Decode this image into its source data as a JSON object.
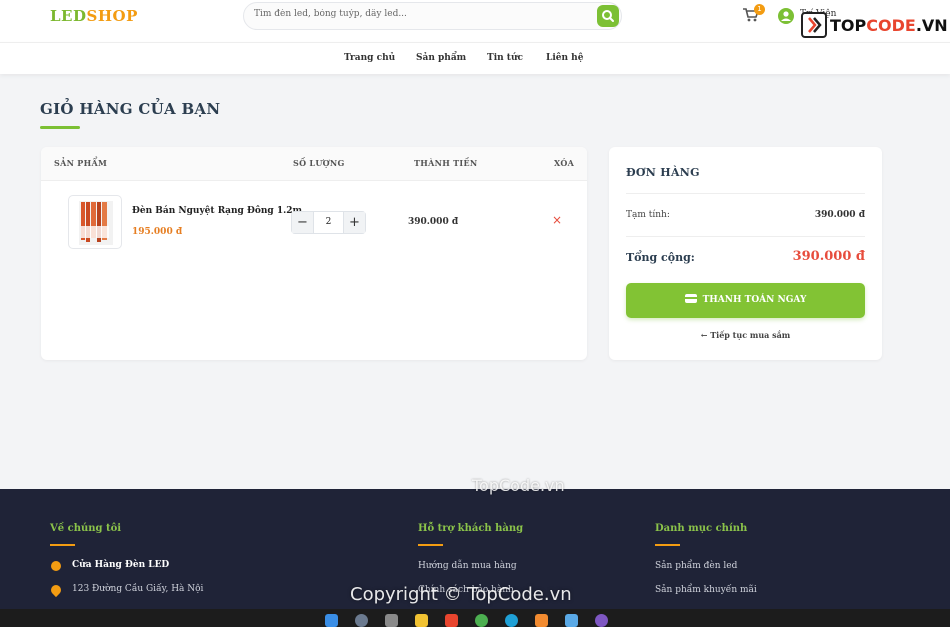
{
  "header": {
    "logo_part1": "LED",
    "logo_part2": "SHOP",
    "search_placeholder": "Tìm đèn led, bóng tuýp, dây led...",
    "cart_count": "1",
    "user_name": "Trí Viện"
  },
  "watermark": {
    "logo_top": "TOP",
    "logo_code": "CODE",
    "logo_suffix": ".VN",
    "mid": "TopCode.vn",
    "bottom": "Copyright © TopCode.vn"
  },
  "nav": {
    "items": [
      "Trang chủ",
      "Sản phẩm",
      "Tin tức",
      "Liên hệ"
    ]
  },
  "page": {
    "title": "GIỎ HÀNG CỦA BẠN"
  },
  "cart": {
    "columns": [
      "SẢN PHẨM",
      "SỐ LƯỢNG",
      "THÀNH TIỀN",
      "XÓA"
    ],
    "items": [
      {
        "name": "Đèn Bán Nguyệt Rạng Đông 1.2m",
        "price": "195.000 đ",
        "quantity": "2",
        "subtotal": "390.000 đ",
        "remove": "×"
      }
    ],
    "minus": "−",
    "plus": "+"
  },
  "order": {
    "title": "ĐƠN HÀNG",
    "subtotal_label": "Tạm tính:",
    "subtotal_value": "390.000 đ",
    "total_label": "Tổng cộng:",
    "total_value": "390.000 đ",
    "pay_label": "THANH TOÁN NGAY",
    "continue_label": "← Tiếp tục mua sắm"
  },
  "footer": {
    "about_title": "Về chúng tôi",
    "store_name": "Cửa Hàng Đèn LED",
    "address": "123 Đường Cầu Giấy, Hà Nội",
    "support_title": "Hỗ trợ khách hàng",
    "support_items": [
      "Hướng dẫn mua hàng",
      "Chính sách bảo hành"
    ],
    "category_title": "Danh mục chính",
    "category_items": [
      "Sản phẩm đèn led",
      "Sản phẩm khuyến mãi"
    ]
  },
  "colors": {
    "brand_green": "#7cc034",
    "brand_orange": "#f39c12",
    "price_red": "#e74c3c",
    "footer_bg": "#1f2337"
  }
}
